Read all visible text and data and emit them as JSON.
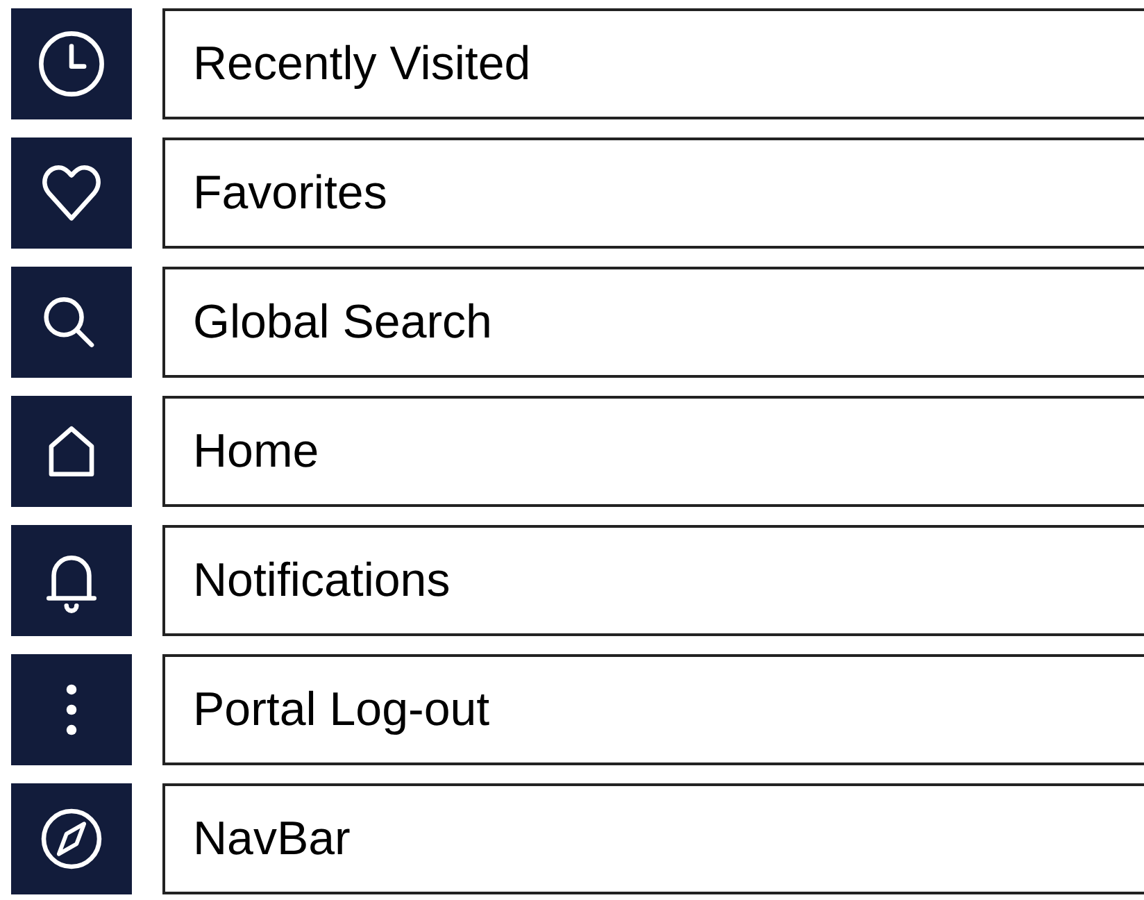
{
  "items": [
    {
      "label": "Recently Visited"
    },
    {
      "label": "Favorites"
    },
    {
      "label": "Global Search"
    },
    {
      "label": "Home"
    },
    {
      "label": "Notifications"
    },
    {
      "label": "Portal Log-out"
    },
    {
      "label": "NavBar"
    }
  ]
}
